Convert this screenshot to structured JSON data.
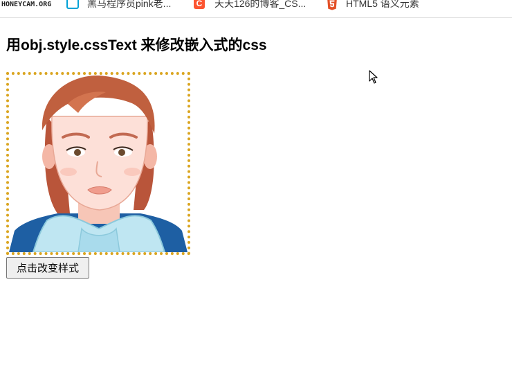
{
  "browser": {
    "bookmarks": [
      {
        "label": "黑马程序员pink老...",
        "icon": "bilibili-icon",
        "color": "#00a1d6"
      },
      {
        "label": "天天126的博客_CS...",
        "icon": "csdn-icon",
        "color": "#fc5531"
      },
      {
        "label": "HTML5 语义元素",
        "icon": "html5-icon",
        "color": "#e34f26"
      }
    ],
    "watermark": "HONEYCAM.ORG"
  },
  "page": {
    "title": "用obj.style.cssText 来修改嵌入式的css",
    "image_alt": "cartoon portrait",
    "border_color": "#daa520",
    "button_label": "点击改变样式"
  }
}
